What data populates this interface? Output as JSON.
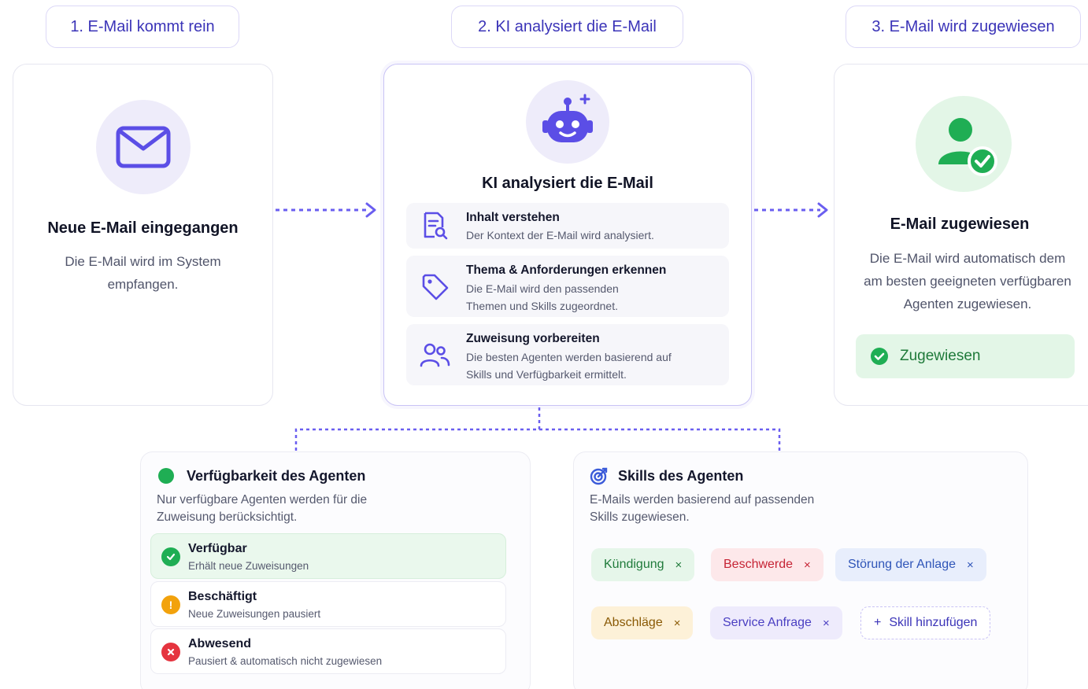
{
  "steps": [
    {
      "label": "1. E-Mail kommt rein"
    },
    {
      "label": "2. KI analysiert die E-Mail"
    },
    {
      "label": "3. E-Mail wird zugewiesen"
    }
  ],
  "card1": {
    "title": "Neue E-Mail eingegangen",
    "desc_line1": "Die E-Mail wird im System",
    "desc_line2": "empfangen.",
    "icon": "mail-icon"
  },
  "card2": {
    "title": "KI analysiert die E-Mail",
    "icon": "robot-icon",
    "rows": [
      {
        "title": "Inhalt verstehen",
        "desc": "Der Kontext der E-Mail wird analysiert.",
        "icon": "document-search-icon"
      },
      {
        "title": "Thema & Anforderungen erkennen",
        "desc": "Die E-Mail wird den passenden Themen und Skills zugeordnet.",
        "icon": "tag-icon"
      },
      {
        "title": "Zuweisung vorbereiten",
        "desc": "Die besten Agenten werden basierend auf Skills und Verfügbarkeit ermittelt.",
        "icon": "users-icon"
      }
    ]
  },
  "card3": {
    "title": "E-Mail zugewiesen",
    "desc_line1": "Die E-Mail wird automatisch dem",
    "desc_line2": "am besten geeigneten verfügbaren",
    "desc_line3": "Agenten zugewiesen.",
    "badge": "Zugewiesen",
    "icon": "user-check-icon"
  },
  "availability": {
    "title": "Verfügbarkeit des Agenten",
    "desc": "Nur verfügbare Agenten werden für die Zuweisung berücksichtigt.",
    "statuses": [
      {
        "title": "Verfügbar",
        "desc": "Erhält neue Zuweisungen",
        "color": "#1fae54",
        "icon": "check-circle-icon"
      },
      {
        "title": "Beschäftigt",
        "desc": "Neue Zuweisungen pausiert",
        "color": "#f2a20c",
        "icon": "alert-circle-icon"
      },
      {
        "title": "Abwesend",
        "desc": "Pausiert & automatisch nicht zugewiesen",
        "color": "#e5343f",
        "icon": "x-circle-icon"
      }
    ]
  },
  "skills": {
    "title": "Skills des Agenten",
    "desc": "E-Mails werden basierend auf passenden Skills zugewiesen.",
    "tags": [
      {
        "label": "Kündigung",
        "bg": "#e6f6ea",
        "fg": "#1f7a3a"
      },
      {
        "label": "Beschwerde",
        "bg": "#fde8ea",
        "fg": "#c62435"
      },
      {
        "label": "Störung der Anlage",
        "bg": "#e8eefc",
        "fg": "#2f55b8"
      },
      {
        "label": "Abschläge",
        "bg": "#fdf1d8",
        "fg": "#8a5a06"
      },
      {
        "label": "Service Anfrage",
        "bg": "#eeebfc",
        "fg": "#4a3fc2"
      }
    ],
    "add_label": "Skill hinzufügen",
    "remove_symbol": "×",
    "add_symbol": "+"
  },
  "colors": {
    "accent": "#5b4ee6",
    "success": "#1fae54",
    "warning": "#f2a20c",
    "danger": "#e5343f"
  }
}
